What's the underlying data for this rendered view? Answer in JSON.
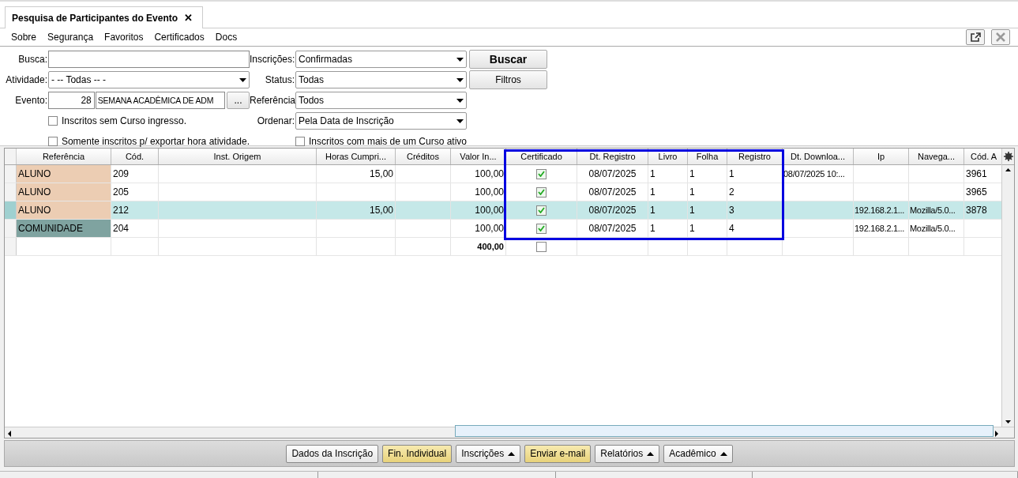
{
  "tab": {
    "title": "Pesquisa de Participantes do Evento",
    "close": "✕",
    "selected": true
  },
  "menu": [
    {
      "label": "Sobre"
    },
    {
      "label": "Segurança"
    },
    {
      "label": "Favoritos"
    },
    {
      "label": "Certificados"
    },
    {
      "label": "Docs"
    }
  ],
  "form": {
    "busca": {
      "label": "Busca:"
    },
    "atividade": {
      "label": "Atividade:",
      "value": "- -- Todas -- -"
    },
    "evento": {
      "label": "Evento:",
      "code": "28",
      "name": "SEMANA ACADÊMICA DE ADM",
      "browse": "..."
    },
    "sem_curso": {
      "label": "Inscritos sem Curso ingresso.",
      "checked": false
    },
    "somente": {
      "label": "Somente inscritos p/ exportar hora atividade.",
      "checked": false
    },
    "inscricoes": {
      "label": "Inscrições:",
      "value": "Confirmadas"
    },
    "status": {
      "label": "Status:",
      "value": "Todas"
    },
    "referencia": {
      "label": "Referência",
      "value": "Todos"
    },
    "ordenar": {
      "label": "Ordenar:",
      "value": "Pela Data de Inscrição"
    },
    "mais_curso": {
      "label": "Inscritos com mais de um Curso ativo",
      "checked": false
    },
    "buscar": "Buscar",
    "filtros": "Filtros"
  },
  "table": {
    "columns": [
      {
        "label": "Referência",
        "highlighted": false
      },
      {
        "label": "Cód.",
        "highlighted": false
      },
      {
        "label": "Inst. Origem",
        "highlighted": false
      },
      {
        "label": "Horas Cumpri...",
        "highlighted": false
      },
      {
        "label": "Créditos",
        "highlighted": false
      },
      {
        "label": "Valor In...",
        "highlighted": false
      },
      {
        "label": "Certificado",
        "highlighted": true
      },
      {
        "label": "Dt. Registro",
        "highlighted": true
      },
      {
        "label": "Livro",
        "highlighted": true
      },
      {
        "label": "Folha",
        "highlighted": true
      },
      {
        "label": "Registro",
        "highlighted": true
      },
      {
        "label": "Dt. Downloa...",
        "highlighted": false
      },
      {
        "label": "Ip",
        "highlighted": false
      },
      {
        "label": "Navega...",
        "highlighted": false
      },
      {
        "label": "Cód. A",
        "highlighted": false
      }
    ],
    "rows": [
      {
        "selected": false,
        "referencia": "ALUNO",
        "color": "#eccdb3",
        "cod": "209",
        "horas": "15,00",
        "valor": "100,00",
        "certificado": true,
        "dt_registro": "08/07/2025",
        "livro": "1",
        "folha": "1",
        "registro": "1",
        "dt_download": "08/07/2025 10:...",
        "ip": "",
        "navegador": "",
        "cod_a": "3961"
      },
      {
        "selected": false,
        "referencia": "ALUNO",
        "color": "#eccdb3",
        "cod": "205",
        "horas": "",
        "valor": "100,00",
        "certificado": true,
        "dt_registro": "08/07/2025",
        "livro": "1",
        "folha": "1",
        "registro": "2",
        "dt_download": "",
        "ip": "",
        "navegador": "",
        "cod_a": "3965"
      },
      {
        "selected": true,
        "referencia": "ALUNO",
        "color": "#eccdb3",
        "cod": "212",
        "horas": "15,00",
        "valor": "100,00",
        "certificado": true,
        "dt_registro": "08/07/2025",
        "livro": "1",
        "folha": "1",
        "registro": "3",
        "dt_download": "",
        "ip": "192.168.2.1...",
        "navegador": "Mozilla/5.0...",
        "cod_a": "3878"
      },
      {
        "selected": false,
        "referencia": "COMUNIDADE",
        "color": "#7fa3a0",
        "cod": "204",
        "horas": "",
        "valor": "100,00",
        "certificado": true,
        "dt_registro": "08/07/2025",
        "livro": "1",
        "folha": "1",
        "registro": "4",
        "dt_download": "",
        "ip": "192.168.2.1...",
        "navegador": "Mozilla/5.0...",
        "cod_a": ""
      }
    ],
    "totals": {
      "valor": "400,00",
      "certificado": false
    }
  },
  "actions": [
    {
      "label": "Dados da Inscrição",
      "kind": "plain",
      "menu": false
    },
    {
      "label": "Fin. Individual",
      "kind": "accent",
      "menu": false
    },
    {
      "label": "Inscrições",
      "kind": "plain",
      "menu": true
    },
    {
      "label": "Enviar e-mail",
      "kind": "accent",
      "menu": false
    },
    {
      "label": "Relatórios",
      "kind": "plain",
      "menu": true
    },
    {
      "label": "Acadêmico",
      "kind": "plain",
      "menu": true
    }
  ]
}
